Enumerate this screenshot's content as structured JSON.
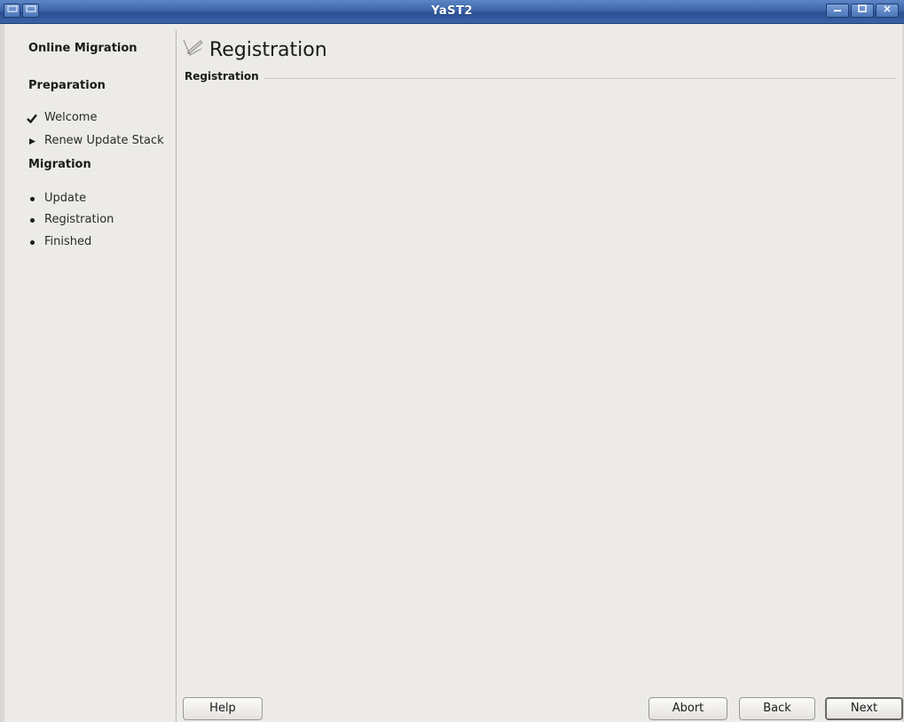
{
  "window": {
    "title": "YaST2",
    "controls": {
      "minimize_icon": "minimize-icon",
      "maximize_icon": "maximize-icon",
      "close_icon": "close-icon"
    }
  },
  "sidebar": {
    "title": "Online Migration",
    "sections": [
      {
        "heading": "Preparation",
        "items": [
          {
            "label": "Welcome",
            "state": "done",
            "icon": "checkmark-icon"
          },
          {
            "label": "Renew Update Stack",
            "state": "current",
            "icon": "arrow-right-icon"
          }
        ]
      },
      {
        "heading": "Migration",
        "items": [
          {
            "label": "Update",
            "state": "pending",
            "icon": "bullet-icon"
          },
          {
            "label": "Registration",
            "state": "pending",
            "icon": "bullet-icon"
          },
          {
            "label": "Finished",
            "state": "pending",
            "icon": "bullet-icon"
          }
        ]
      }
    ]
  },
  "main": {
    "title": "Registration",
    "title_icon": "registration-pen-icon",
    "frame_label": "Registration"
  },
  "buttons": {
    "help": "Help",
    "abort": "Abort",
    "back": "Back",
    "next": "Next"
  },
  "colors": {
    "titlebar": "#3d66aa",
    "background": "#ecebe7"
  }
}
